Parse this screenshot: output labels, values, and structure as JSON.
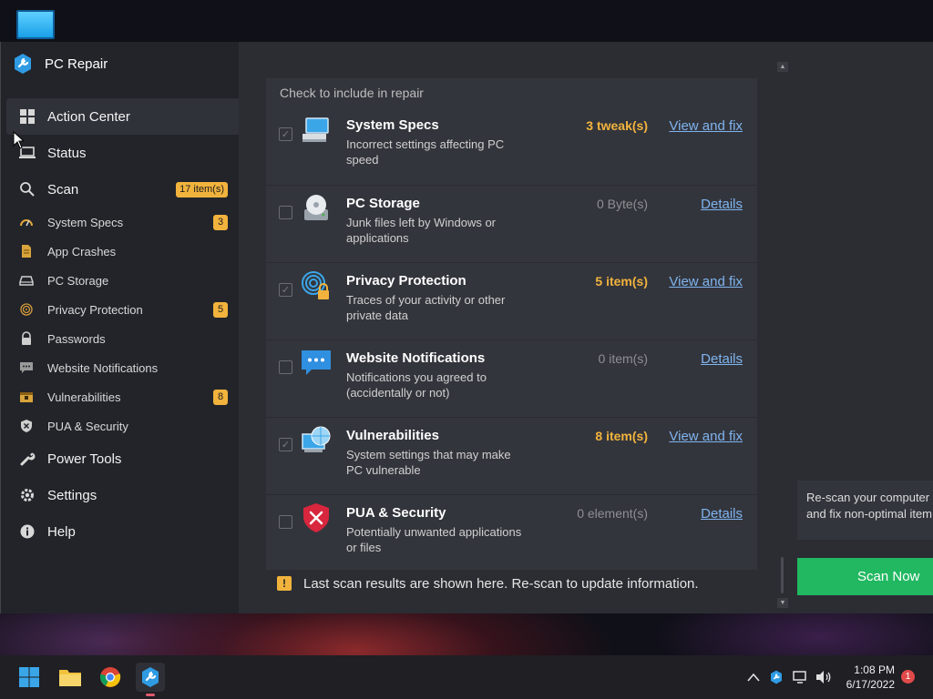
{
  "app": {
    "title": "PC Repair"
  },
  "sidebar": {
    "items": [
      {
        "label": "Action Center",
        "icon": "grid-icon"
      },
      {
        "label": "Status",
        "icon": "laptop-icon"
      },
      {
        "label": "Scan",
        "icon": "search-icon",
        "badge": "17 item(s)"
      },
      {
        "label": "System Specs",
        "icon": "gauge-icon",
        "badge": "3"
      },
      {
        "label": "App Crashes",
        "icon": "document-icon"
      },
      {
        "label": "PC Storage",
        "icon": "drive-icon"
      },
      {
        "label": "Privacy Protection",
        "icon": "fingerprint-icon",
        "badge": "5"
      },
      {
        "label": "Passwords",
        "icon": "lock-icon"
      },
      {
        "label": "Website Notifications",
        "icon": "chat-icon"
      },
      {
        "label": "Vulnerabilities",
        "icon": "chest-icon",
        "badge": "8"
      },
      {
        "label": "PUA & Security",
        "icon": "shield-icon"
      },
      {
        "label": "Power Tools",
        "icon": "wrench-icon"
      },
      {
        "label": "Settings",
        "icon": "gear-icon"
      },
      {
        "label": "Help",
        "icon": "info-icon"
      }
    ]
  },
  "main": {
    "header": "Check to include in repair",
    "rows": [
      {
        "title": "System Specs",
        "desc": "Incorrect settings affecting PC speed",
        "count": "3 tweak(s)",
        "action": "View and fix",
        "checked": true
      },
      {
        "title": "PC Storage",
        "desc": "Junk files left by Windows or applications",
        "count": "0 Byte(s)",
        "action": "Details",
        "checked": false
      },
      {
        "title": "Privacy Protection",
        "desc": "Traces of your activity or other private data",
        "count": "5 item(s)",
        "action": "View and fix",
        "checked": true
      },
      {
        "title": "Website Notifications",
        "desc": "Notifications you agreed to (accidentally or not)",
        "count": "0 item(s)",
        "action": "Details",
        "checked": false
      },
      {
        "title": "Vulnerabilities",
        "desc": "System settings that may make PC vulnerable",
        "count": "8 item(s)",
        "action": "View and fix",
        "checked": true
      },
      {
        "title": "PUA & Security",
        "desc": "Potentially unwanted applications or files",
        "count": "0 element(s)",
        "action": "Details",
        "checked": false
      }
    ],
    "note": "Last scan results are shown here. Re-scan to update information.",
    "rescan_line1": "Re-scan your computer",
    "rescan_line2": "and fix non-optimal item",
    "scan_button": "Scan Now"
  },
  "taskbar": {
    "time": "1:08 PM",
    "date": "6/17/2022",
    "notifications": "1"
  },
  "colors": {
    "accent": "#f2b33d",
    "link": "#7fb4ef",
    "scan_button": "#21b861"
  }
}
